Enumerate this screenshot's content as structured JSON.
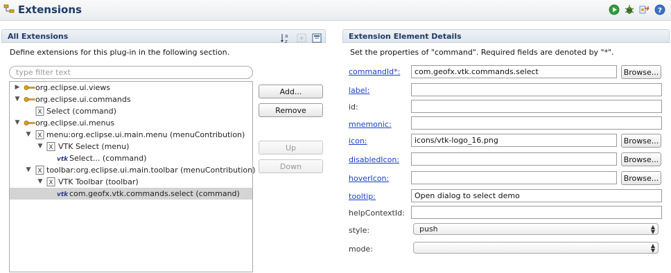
{
  "header": {
    "title": "Extensions"
  },
  "left": {
    "section_title": "All Extensions",
    "description": "Define extensions for this plug-in in the following section.",
    "filter_placeholder": "type filter text",
    "tree": [
      {
        "label": "org.eclipse.ui.views",
        "icon": "extension-point-icon",
        "expanded": false
      },
      {
        "label": "org.eclipse.ui.commands",
        "icon": "extension-point-icon",
        "expanded": true
      },
      {
        "label": "Select (command)",
        "icon": "element-x-icon"
      },
      {
        "label": "org.eclipse.ui.menus",
        "icon": "extension-point-icon",
        "expanded": true
      },
      {
        "label": "menu:org.eclipse.ui.main.menu (menuContribution)",
        "icon": "element-x-icon",
        "expanded": true
      },
      {
        "label": "VTK Select (menu)",
        "icon": "element-x-icon",
        "expanded": true
      },
      {
        "label": "Select... (command)",
        "icon": "vtk-logo-icon"
      },
      {
        "label": "toolbar:org.eclipse.ui.main.toolbar (menuContribution)",
        "icon": "element-x-icon",
        "expanded": true
      },
      {
        "label": "VTK Toolbar (toolbar)",
        "icon": "element-x-icon",
        "expanded": true
      },
      {
        "label": "com.geofx.vtk.commands.select (command)",
        "icon": "vtk-logo-icon",
        "selected": true
      }
    ],
    "buttons": {
      "add": "Add...",
      "remove": "Remove",
      "up": "Up",
      "down": "Down"
    }
  },
  "right": {
    "section_title": "Extension Element Details",
    "description": "Set the properties of \"command\". Required fields are denoted by \"*\".",
    "browse_label": "Browse...",
    "fields": {
      "commandId": {
        "label": "commandId*:",
        "value": "com.geofx.vtk.commands.select"
      },
      "label": {
        "label": "label:",
        "value": ""
      },
      "id": {
        "label": "id:",
        "value": ""
      },
      "mnemonic": {
        "label": "mnemonic:",
        "value": ""
      },
      "icon": {
        "label": "icon:",
        "value": "icons/vtk-logo_16.png"
      },
      "disabledIcon": {
        "label": "disabledIcon:",
        "value": ""
      },
      "hoverIcon": {
        "label": "hoverIcon:",
        "value": ""
      },
      "tooltip": {
        "label": "tooltip:",
        "value": "Open dialog to select demo"
      },
      "helpContextId": {
        "label": "helpContextId:",
        "value": ""
      },
      "style": {
        "label": "style:",
        "value": "push"
      },
      "mode": {
        "label": "mode:",
        "value": ""
      }
    }
  },
  "colors": {
    "title": "#1f3a68",
    "link": "#1a3ec8",
    "selection": "#d4d4d4"
  }
}
